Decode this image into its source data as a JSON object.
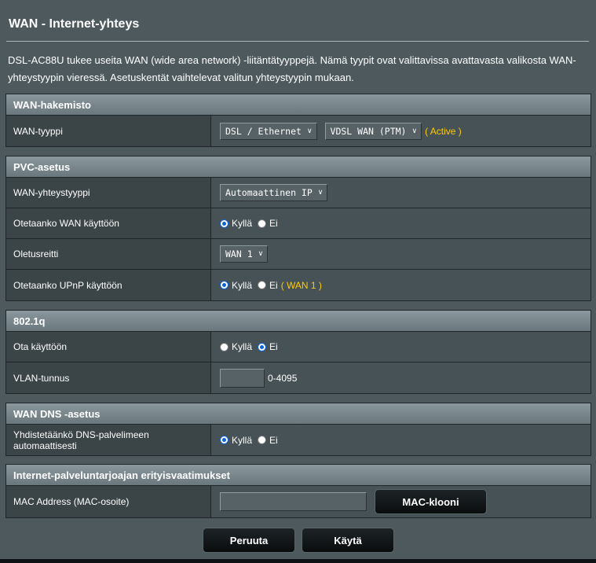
{
  "page": {
    "title": "WAN - Internet-yhteys",
    "description": "DSL-AC88U tukee useita WAN (wide area network) -liitäntätyyppejä. Nämä tyypit ovat valittavissa avattavasta valikosta WAN-yhteystyypin vieressä. Asetuskentät vaihtelevat valitun yhteystyypin mukaan."
  },
  "wan_index": {
    "header": "WAN-hakemisto",
    "wan_type_label": "WAN-tyyppi",
    "wan_type_value": "DSL / Ethernet",
    "dsl_mode_value": "VDSL WAN (PTM)",
    "status_note": "( Active )"
  },
  "pvc": {
    "header": "PVC-asetus",
    "conn_type_label": "WAN-yhteystyyppi",
    "conn_type_value": "Automaattinen IP",
    "enable_wan_label": "Otetaanko WAN käyttöön",
    "default_route_label": "Oletusreitti",
    "default_route_value": "WAN 1",
    "enable_upnp_label": "Otetaanko UPnP käyttöön",
    "upnp_note": "( WAN 1 )"
  },
  "vlan": {
    "header": "802.1q",
    "enable_label": "Ota käyttöön",
    "vlan_id_label": "VLAN-tunnus",
    "vlan_id_value": "",
    "vlan_range": "0-4095"
  },
  "dns": {
    "header": "WAN DNS -asetus",
    "auto_label": "Yhdistetäänkö DNS-palvelimeen automaattisesti"
  },
  "isp": {
    "header": "Internet-palveluntarjoajan erityisvaatimukset",
    "mac_label": "MAC Address (MAC-osoite)",
    "mac_value": "",
    "mac_clone_button": "MAC-klooni"
  },
  "radio": {
    "yes": "Kyllä",
    "no": "Ei"
  },
  "actions": {
    "cancel": "Peruuta",
    "apply": "Käytä"
  },
  "colors": {
    "accent_note": "#ffcc00",
    "radio_selected": "#0a64d8",
    "background": "#4d595d"
  },
  "icons": {
    "dropdown": "chevron-down-icon",
    "radio_on": "radio-selected-icon",
    "radio_off": "radio-unselected-icon"
  }
}
